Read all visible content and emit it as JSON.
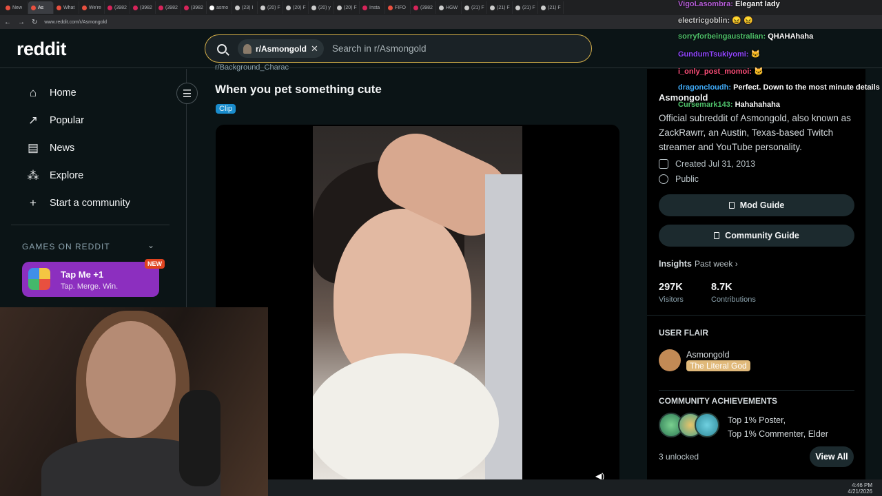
{
  "browser": {
    "tabs": [
      "New",
      "As",
      "What",
      "We're",
      "(3982",
      "(3982",
      "(3982",
      "(3982",
      "asmo",
      "(23) I",
      "(20) F",
      "(20) F",
      "(20) y",
      "(20) F",
      "Insta",
      "FIFO",
      "(3982",
      "HGW",
      "(21) F",
      "(21) F",
      "(21) F",
      "(21) F"
    ],
    "url": "www.reddit.com/r/Asmongold"
  },
  "header": {
    "logo": "reddit",
    "search_chip": "r/Asmongold",
    "search_chip_close": "✕",
    "search_placeholder": "Search in r/Asmongold"
  },
  "leftnav": {
    "items": [
      {
        "label": "Home",
        "icon": "home-icon"
      },
      {
        "label": "Popular",
        "icon": "popular-icon"
      },
      {
        "label": "News",
        "icon": "news-icon"
      },
      {
        "label": "Explore",
        "icon": "explore-icon"
      },
      {
        "label": "Start a community",
        "icon": "plus-icon"
      }
    ],
    "games_heading": "GAMES ON REDDIT",
    "game": {
      "title": "Tap Me +1",
      "subtitle": "Tap. Merge. Win.",
      "badge": "NEW"
    }
  },
  "post": {
    "subreddit": "r/Background_Charac",
    "title": "When you pet something cute",
    "flair": "Clip"
  },
  "sidebar": {
    "name": "Asmongold",
    "description": "Official subreddit of Asmongold, also known as ZackRawrr, an Austin, Texas-based Twitch streamer and YouTube personality.",
    "created": "Created Jul 31, 2013",
    "visibility": "Public",
    "mod_guide": "Mod Guide",
    "community_guide": "Community Guide",
    "insights": "Insights",
    "insights_period": "Past week ›",
    "stats": [
      {
        "value": "297K",
        "label": "Visitors"
      },
      {
        "value": "8.7K",
        "label": "Contributions"
      }
    ],
    "user_flair_heading": "USER FLAIR",
    "flair_username": "Asmongold",
    "flair_tag": "The Literal God",
    "achievements_heading": "COMMUNITY ACHIEVEMENTS",
    "achievements_line1": "Top 1% Poster,",
    "achievements_line2": "Top 1% Commenter, Elder",
    "unlocked": "3 unlocked",
    "view_all": "View All"
  },
  "chat": [
    {
      "user": "VigoLasombra:",
      "msg": "Elegant lady",
      "color": "#b45cd6"
    },
    {
      "user": "electricgoblin:",
      "msg": "",
      "color": "#c8c8c8"
    },
    {
      "user": "sorryforbeingaustralian:",
      "msg": "QHAHAhaha",
      "color": "#4fc26b"
    },
    {
      "user": "GundumTsukiyomi:",
      "msg": "",
      "color": "#9146ff"
    },
    {
      "user": "i_only_post_momoi:",
      "msg": "",
      "color": "#ff4f7a"
    },
    {
      "user": "dragoncloudh:",
      "msg": "Perfect. Down to the most minute details",
      "color": "#3fa9f5"
    },
    {
      "user": "Cursemark143:",
      "msg": "Hahahahaha",
      "color": "#4fc26b"
    }
  ],
  "taskbar": {
    "time": "4:46 PM",
    "date": "4/21/2026"
  }
}
